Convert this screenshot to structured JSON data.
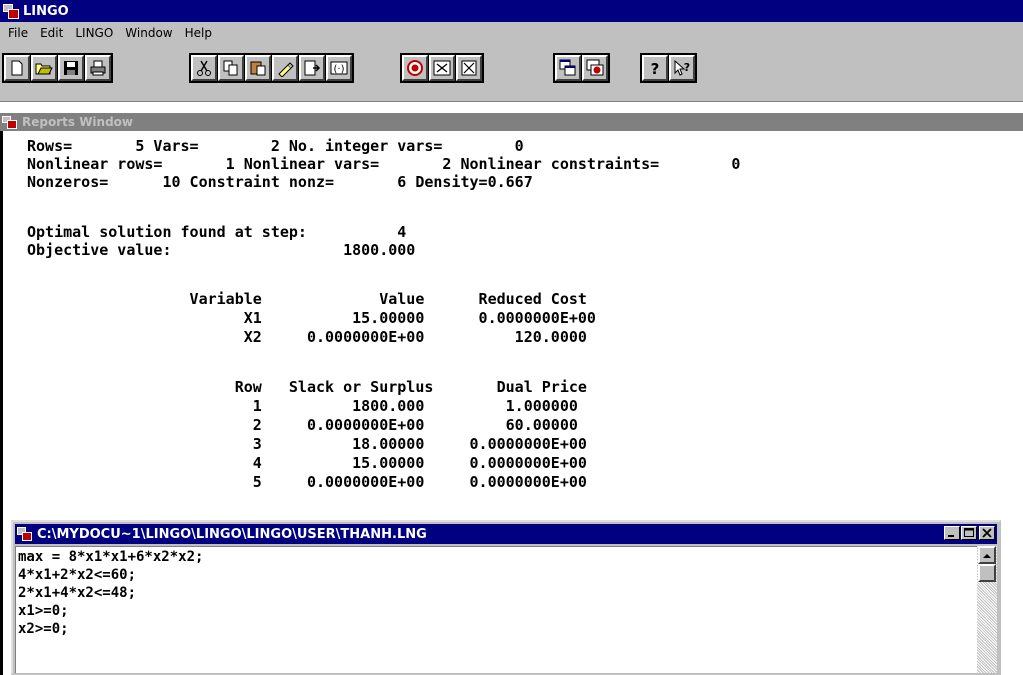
{
  "app": {
    "title": "LINGO",
    "icon": "lingo-app-icon"
  },
  "menu": {
    "items": [
      "File",
      "Edit",
      "LINGO",
      "Window",
      "Help"
    ]
  },
  "toolbar": {
    "icons": [
      "new-file-icon",
      "open-file-icon",
      "save-icon",
      "print-icon",
      "cut-icon",
      "copy-icon",
      "paste-icon",
      "find-icon",
      "go-to-line-icon",
      "match-parenthesis-icon",
      "solve-icon",
      "solution-icon",
      "close-all-icon",
      "tile-icon",
      "cascade-icon",
      "help-icon",
      "context-help-icon"
    ]
  },
  "reports": {
    "title": "Reports Window",
    "lines": [
      "Rows=       5 Vars=        2 No. integer vars=        0",
      "Nonlinear rows=       1 Nonlinear vars=       2 Nonlinear constraints=        0",
      "Nonzeros=      10 Constraint nonz=       6 Density=0.667",
      "",
      "Optimal solution found at step:          4",
      "Objective value:                   1800.000",
      "",
      "                  Variable             Value      Reduced Cost",
      "                        X1          15.00000      0.0000000E+00",
      "                        X2     0.0000000E+00          120.0000",
      "",
      "                       Row   Slack or Surplus       Dual Price",
      "                         1          1800.000         1.000000",
      "                         2     0.0000000E+00         60.00000",
      "                         3          18.00000     0.0000000E+00",
      "                         4          15.00000     0.0000000E+00",
      "                         5     0.0000000E+00     0.0000000E+00"
    ]
  },
  "editor": {
    "title": "C:\\MYDOCU~1\\LINGO\\LINGO\\LINGO\\USER\\THANH.LNG",
    "lines": [
      "max = 8*x1*x1+6*x2*x2;",
      "4*x1+2*x2<=60;",
      "2*x1+4*x2<=48;",
      "x1>=0;",
      "x2>=0;"
    ]
  }
}
